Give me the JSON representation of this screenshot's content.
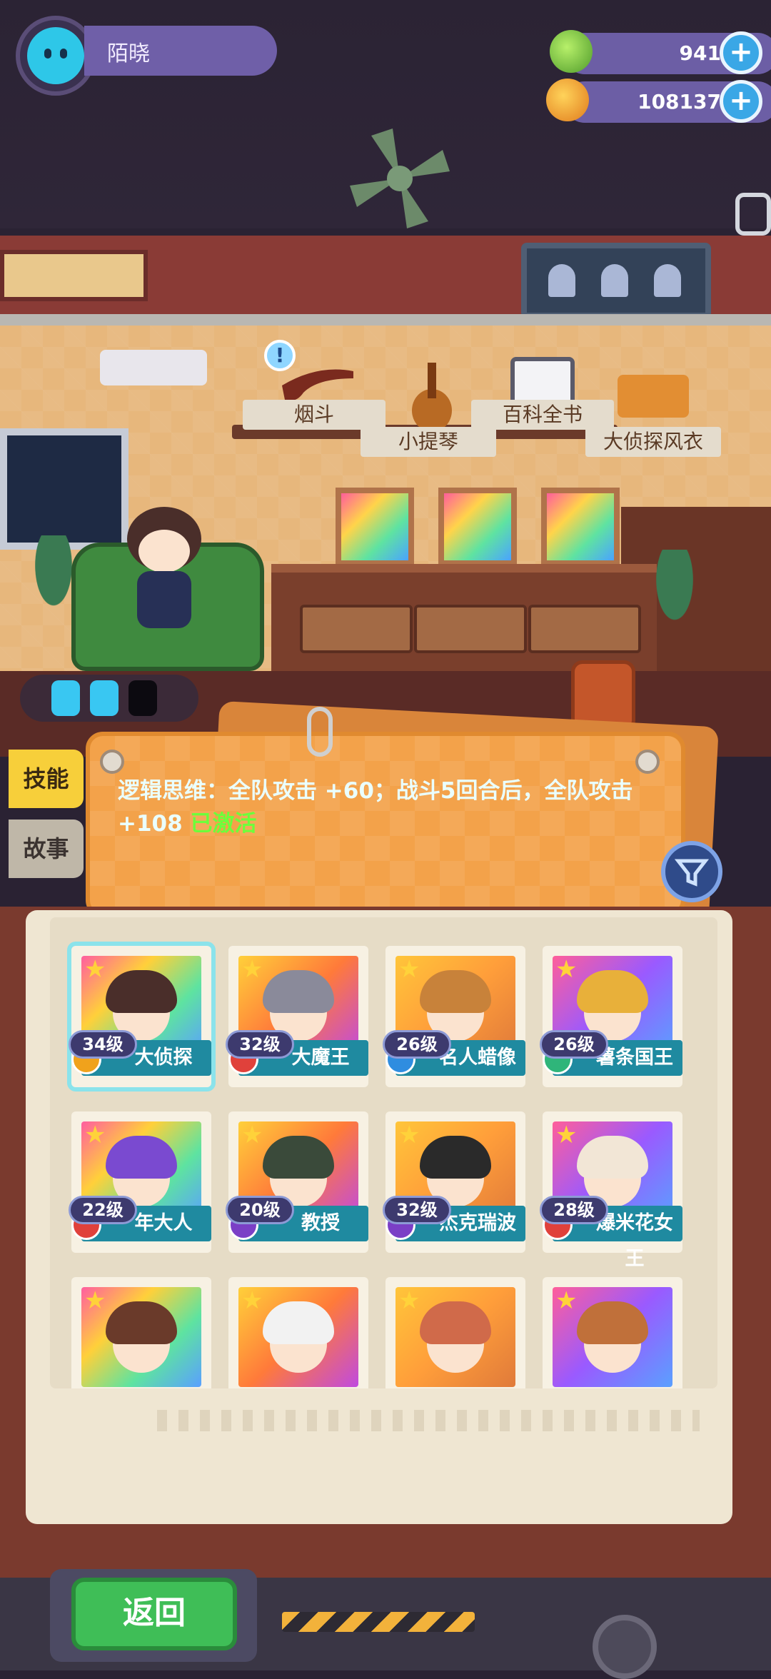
{
  "player": {
    "name": "陌晓"
  },
  "currency": {
    "gems": "941",
    "coins": "108137"
  },
  "room_items": [
    {
      "label": "烟斗"
    },
    {
      "label": "小提琴"
    },
    {
      "label": "百科全书"
    },
    {
      "label": "大侦探风衣"
    }
  ],
  "skill": {
    "text": "逻辑思维：全队攻击 +60；战斗5回合后，全队攻击 +108",
    "status": "已激活"
  },
  "side_tabs": {
    "skill": "技能",
    "story": "故事"
  },
  "characters": [
    {
      "name": "大侦探",
      "level": "34级",
      "badge": "gold"
    },
    {
      "name": "大魔王",
      "level": "32级",
      "badge": "red"
    },
    {
      "name": "名人蜡像",
      "level": "26级",
      "badge": "blue"
    },
    {
      "name": "薯条国王",
      "level": "26级",
      "badge": "green"
    },
    {
      "name": "年大人",
      "level": "22级",
      "badge": "red"
    },
    {
      "name": "教授",
      "level": "20级",
      "badge": "purple"
    },
    {
      "name": "杰克瑞波",
      "level": "32级",
      "badge": "purple"
    },
    {
      "name": "爆米花女王",
      "level": "28级",
      "badge": "red"
    },
    {
      "name": "",
      "level": "",
      "badge": ""
    },
    {
      "name": "",
      "level": "",
      "badge": ""
    },
    {
      "name": "",
      "level": "",
      "badge": ""
    },
    {
      "name": "",
      "level": "",
      "badge": ""
    }
  ],
  "buttons": {
    "back": "返回"
  },
  "colors": {
    "badge_gold": "#f0a21c",
    "badge_red": "#e0413b",
    "badge_blue": "#2f8de0",
    "badge_green": "#2fb57a",
    "badge_purple": "#7b3fc6"
  }
}
